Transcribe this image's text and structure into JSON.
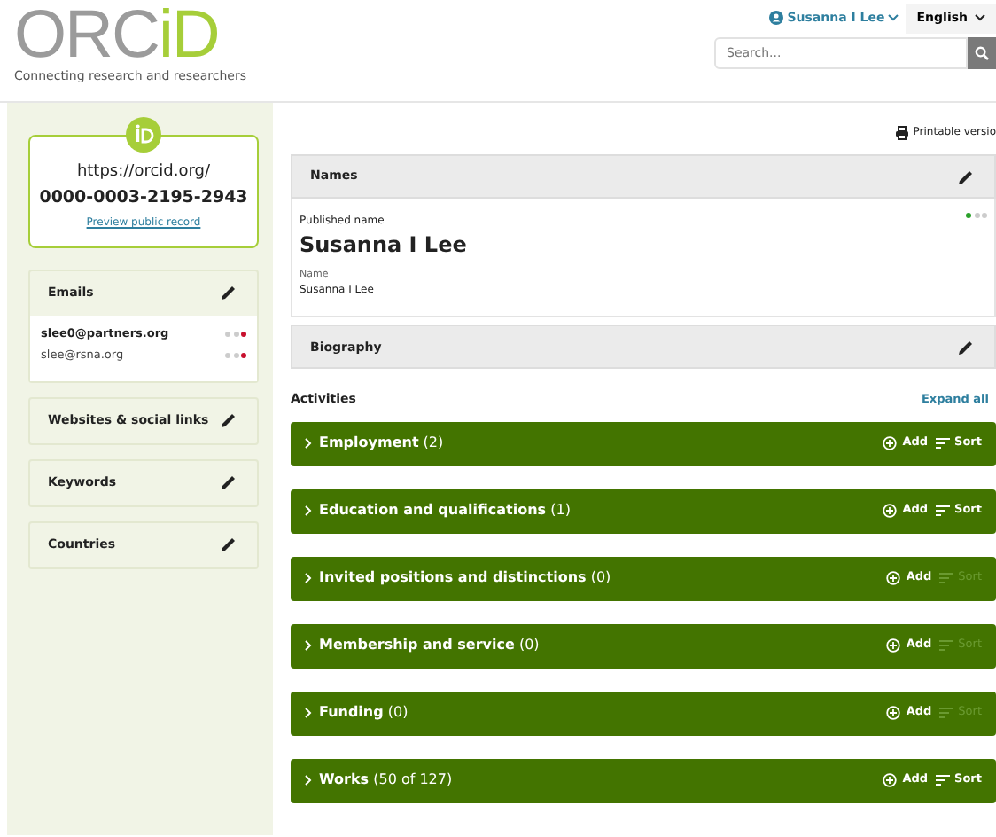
{
  "header": {
    "logo_primary": "ORC",
    "logo_accent": "iD",
    "tagline": "Connecting research and researchers",
    "user_name": "Susanna I Lee",
    "language": "English",
    "search": {
      "placeholder": "Search..."
    }
  },
  "sidebar": {
    "orcid": {
      "url": "https://orcid.org/",
      "id": "0000-0003-2195-2943",
      "preview_link": "Preview public record"
    },
    "sections": [
      {
        "title": "Emails",
        "items": [
          {
            "text": "slee0@partners.org",
            "primary": true,
            "color": "#c8102e"
          },
          {
            "text": "slee@rsna.org",
            "primary": false,
            "color": "#c8102e"
          }
        ]
      },
      {
        "title": "Websites & social links"
      },
      {
        "title": "Keywords"
      },
      {
        "title": "Countries"
      }
    ]
  },
  "main": {
    "print_link": "Printable versio",
    "names": {
      "title": "Names",
      "published_label": "Published name",
      "published_name": "Susanna I Lee",
      "name_label": "Name",
      "name": "Susanna I Lee",
      "color": "#2aa12a"
    },
    "biography": {
      "title": "Biography"
    },
    "activities_label": "Activities",
    "expand_all": "Expand all",
    "activities": [
      {
        "title": "Employment",
        "count": "(2)",
        "add": "Add",
        "sort": "Sort",
        "sort_enabled": true
      },
      {
        "title": "Education and qualifications",
        "count": "(1)",
        "add": "Add",
        "sort": "Sort",
        "sort_enabled": true
      },
      {
        "title": "Invited positions and distinctions",
        "count": "(0)",
        "add": "Add",
        "sort": "Sort",
        "sort_enabled": false
      },
      {
        "title": "Membership and service",
        "count": "(0)",
        "add": "Add",
        "sort": "Sort",
        "sort_enabled": false
      },
      {
        "title": "Funding",
        "count": "(0)",
        "add": "Add",
        "sort": "Sort",
        "sort_enabled": false
      },
      {
        "title": "Works",
        "count": "(50 of 127)",
        "add": "Add",
        "sort": "Sort",
        "sort_enabled": true
      }
    ]
  }
}
